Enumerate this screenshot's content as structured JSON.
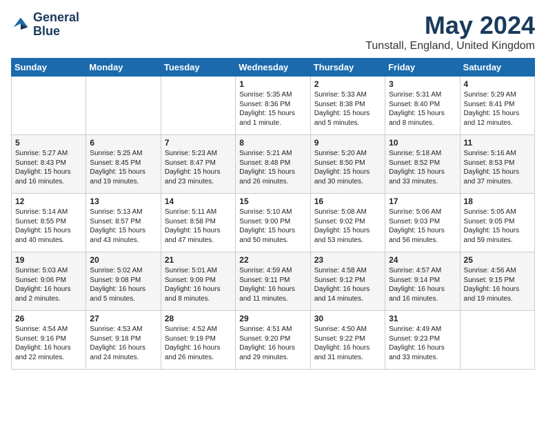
{
  "header": {
    "logo_line1": "General",
    "logo_line2": "Blue",
    "month_title": "May 2024",
    "location": "Tunstall, England, United Kingdom"
  },
  "days_of_week": [
    "Sunday",
    "Monday",
    "Tuesday",
    "Wednesday",
    "Thursday",
    "Friday",
    "Saturday"
  ],
  "weeks": [
    [
      {
        "day": "",
        "info": ""
      },
      {
        "day": "",
        "info": ""
      },
      {
        "day": "",
        "info": ""
      },
      {
        "day": "1",
        "info": "Sunrise: 5:35 AM\nSunset: 8:36 PM\nDaylight: 15 hours\nand 1 minute."
      },
      {
        "day": "2",
        "info": "Sunrise: 5:33 AM\nSunset: 8:38 PM\nDaylight: 15 hours\nand 5 minutes."
      },
      {
        "day": "3",
        "info": "Sunrise: 5:31 AM\nSunset: 8:40 PM\nDaylight: 15 hours\nand 8 minutes."
      },
      {
        "day": "4",
        "info": "Sunrise: 5:29 AM\nSunset: 8:41 PM\nDaylight: 15 hours\nand 12 minutes."
      }
    ],
    [
      {
        "day": "5",
        "info": "Sunrise: 5:27 AM\nSunset: 8:43 PM\nDaylight: 15 hours\nand 16 minutes."
      },
      {
        "day": "6",
        "info": "Sunrise: 5:25 AM\nSunset: 8:45 PM\nDaylight: 15 hours\nand 19 minutes."
      },
      {
        "day": "7",
        "info": "Sunrise: 5:23 AM\nSunset: 8:47 PM\nDaylight: 15 hours\nand 23 minutes."
      },
      {
        "day": "8",
        "info": "Sunrise: 5:21 AM\nSunset: 8:48 PM\nDaylight: 15 hours\nand 26 minutes."
      },
      {
        "day": "9",
        "info": "Sunrise: 5:20 AM\nSunset: 8:50 PM\nDaylight: 15 hours\nand 30 minutes."
      },
      {
        "day": "10",
        "info": "Sunrise: 5:18 AM\nSunset: 8:52 PM\nDaylight: 15 hours\nand 33 minutes."
      },
      {
        "day": "11",
        "info": "Sunrise: 5:16 AM\nSunset: 8:53 PM\nDaylight: 15 hours\nand 37 minutes."
      }
    ],
    [
      {
        "day": "12",
        "info": "Sunrise: 5:14 AM\nSunset: 8:55 PM\nDaylight: 15 hours\nand 40 minutes."
      },
      {
        "day": "13",
        "info": "Sunrise: 5:13 AM\nSunset: 8:57 PM\nDaylight: 15 hours\nand 43 minutes."
      },
      {
        "day": "14",
        "info": "Sunrise: 5:11 AM\nSunset: 8:58 PM\nDaylight: 15 hours\nand 47 minutes."
      },
      {
        "day": "15",
        "info": "Sunrise: 5:10 AM\nSunset: 9:00 PM\nDaylight: 15 hours\nand 50 minutes."
      },
      {
        "day": "16",
        "info": "Sunrise: 5:08 AM\nSunset: 9:02 PM\nDaylight: 15 hours\nand 53 minutes."
      },
      {
        "day": "17",
        "info": "Sunrise: 5:06 AM\nSunset: 9:03 PM\nDaylight: 15 hours\nand 56 minutes."
      },
      {
        "day": "18",
        "info": "Sunrise: 5:05 AM\nSunset: 9:05 PM\nDaylight: 15 hours\nand 59 minutes."
      }
    ],
    [
      {
        "day": "19",
        "info": "Sunrise: 5:03 AM\nSunset: 9:06 PM\nDaylight: 16 hours\nand 2 minutes."
      },
      {
        "day": "20",
        "info": "Sunrise: 5:02 AM\nSunset: 9:08 PM\nDaylight: 16 hours\nand 5 minutes."
      },
      {
        "day": "21",
        "info": "Sunrise: 5:01 AM\nSunset: 9:09 PM\nDaylight: 16 hours\nand 8 minutes."
      },
      {
        "day": "22",
        "info": "Sunrise: 4:59 AM\nSunset: 9:11 PM\nDaylight: 16 hours\nand 11 minutes."
      },
      {
        "day": "23",
        "info": "Sunrise: 4:58 AM\nSunset: 9:12 PM\nDaylight: 16 hours\nand 14 minutes."
      },
      {
        "day": "24",
        "info": "Sunrise: 4:57 AM\nSunset: 9:14 PM\nDaylight: 16 hours\nand 16 minutes."
      },
      {
        "day": "25",
        "info": "Sunrise: 4:56 AM\nSunset: 9:15 PM\nDaylight: 16 hours\nand 19 minutes."
      }
    ],
    [
      {
        "day": "26",
        "info": "Sunrise: 4:54 AM\nSunset: 9:16 PM\nDaylight: 16 hours\nand 22 minutes."
      },
      {
        "day": "27",
        "info": "Sunrise: 4:53 AM\nSunset: 9:18 PM\nDaylight: 16 hours\nand 24 minutes."
      },
      {
        "day": "28",
        "info": "Sunrise: 4:52 AM\nSunset: 9:19 PM\nDaylight: 16 hours\nand 26 minutes."
      },
      {
        "day": "29",
        "info": "Sunrise: 4:51 AM\nSunset: 9:20 PM\nDaylight: 16 hours\nand 29 minutes."
      },
      {
        "day": "30",
        "info": "Sunrise: 4:50 AM\nSunset: 9:22 PM\nDaylight: 16 hours\nand 31 minutes."
      },
      {
        "day": "31",
        "info": "Sunrise: 4:49 AM\nSunset: 9:23 PM\nDaylight: 16 hours\nand 33 minutes."
      },
      {
        "day": "",
        "info": ""
      }
    ]
  ]
}
